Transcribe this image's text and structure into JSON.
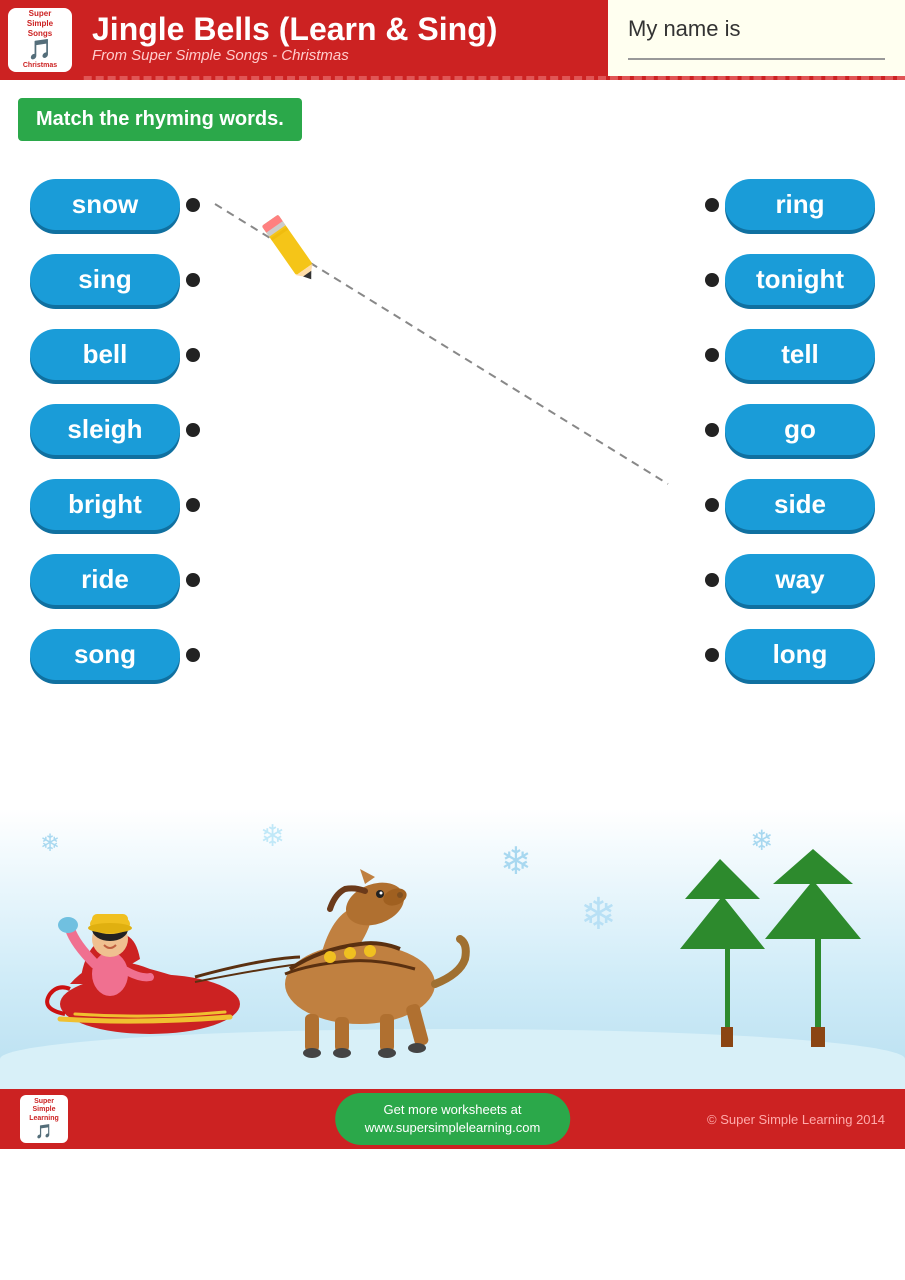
{
  "header": {
    "title": "Jingle Bells (Learn & Sing)",
    "subtitle": "From Super Simple Songs - Christmas",
    "logo_text": "Super Simple Songs Christmas",
    "name_label": "My name is"
  },
  "instruction": "Match the rhyming words.",
  "left_words": [
    "snow",
    "sing",
    "bell",
    "sleigh",
    "bright",
    "ride",
    "song"
  ],
  "right_words": [
    "ring",
    "tonight",
    "tell",
    "go",
    "side",
    "way",
    "long"
  ],
  "footer": {
    "center_line1": "Get more worksheets at",
    "center_line2": "www.supersimplelearning.com",
    "copyright": "© Super Simple Learning 2014"
  },
  "colors": {
    "red": "#cc2222",
    "blue": "#1a9cd8",
    "green": "#2ba84a",
    "pill_shadow": "#1070a0"
  },
  "pencil": {
    "present": true
  }
}
